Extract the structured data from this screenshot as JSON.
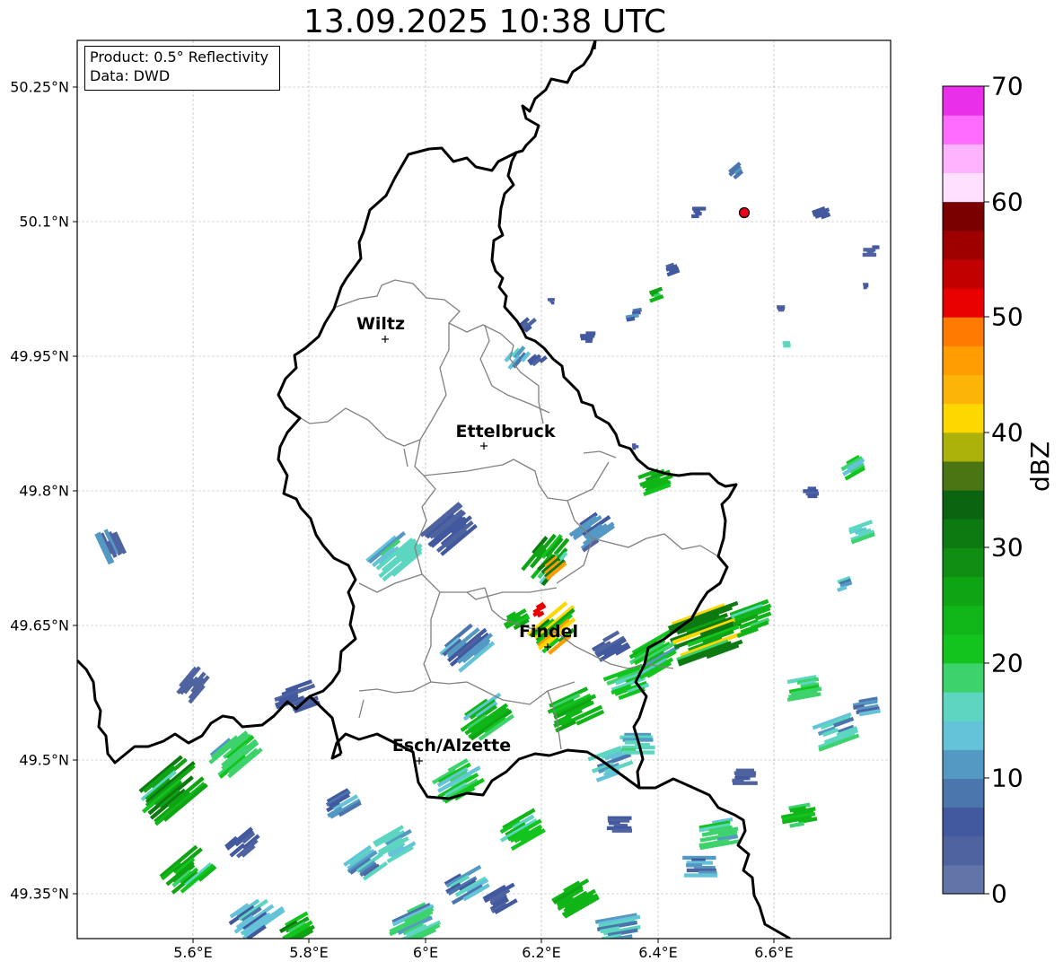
{
  "title": "13.09.2025 10:38 UTC",
  "info_box": {
    "product": "Product: 0.5° Reflectivity",
    "data_source": "Data: DWD"
  },
  "latitude_labels": [
    "50.25°N",
    "50.1°N",
    "49.95°N",
    "49.8°N",
    "49.65°N",
    "49.5°N",
    "49.35°N"
  ],
  "longitude_labels": [
    "5.6°E",
    "5.8°E",
    "6°E",
    "6.2°E",
    "6.4°E",
    "6.6°E"
  ],
  "cities": [
    {
      "name": "Wiltz",
      "lon": 5.93,
      "lat": 49.97
    },
    {
      "name": "Ettelbruck",
      "lon": 6.1,
      "lat": 49.85
    },
    {
      "name": "Findel",
      "lon": 6.21,
      "lat": 49.63
    },
    {
      "name": "Esch/Alzette",
      "lon": 5.99,
      "lat": 49.5
    }
  ],
  "radar_site": {
    "lon": 6.55,
    "lat": 50.11,
    "color": "#e8001a"
  },
  "colorbar": {
    "unit": "dBZ",
    "tick_labels": [
      "70",
      "60",
      "50",
      "40",
      "30",
      "20",
      "10",
      "0"
    ],
    "min": 0,
    "max": 70,
    "colors": [
      "#6374a8",
      "#4f63a0",
      "#42589f",
      "#4b75ad",
      "#5498c4",
      "#64c3d8",
      "#5cd6c0",
      "#3dd26c",
      "#14c41e",
      "#10b518",
      "#0fa414",
      "#0f8e12",
      "#0c7a10",
      "#0a6410",
      "#4a7512",
      "#adb20a",
      "#ffd700",
      "#fbb407",
      "#ff9c00",
      "#ff7a00",
      "#e80000",
      "#c20000",
      "#9e0000",
      "#7a0000",
      "#ffe1ff",
      "#ffb3ff",
      "#ff6bff",
      "#ea2fea"
    ]
  },
  "map_extent": {
    "lon_min": 5.4,
    "lon_max": 6.8,
    "lat_min": 49.3,
    "lat_max": 50.3
  },
  "colors": {
    "border": "#000000",
    "canton_border": "#808080",
    "grid": "#b0b0b0"
  }
}
